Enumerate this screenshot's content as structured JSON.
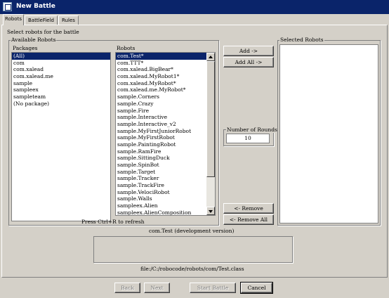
{
  "window": {
    "title": "New Battle"
  },
  "tabs": [
    {
      "label": "Robots"
    },
    {
      "label": "BattleField"
    },
    {
      "label": "Rules"
    }
  ],
  "robots_tab": {
    "instruction": "Select robots for the battle",
    "available_label": "Available Robots",
    "packages_header": "Packages",
    "packages": [
      "(All)",
      "com",
      "com.xalead",
      "com.xalead.me",
      "sample",
      "sampleex",
      "sampleteam",
      "(No package)"
    ],
    "selected_package": "(All)",
    "robots_header": "Robots",
    "robots": [
      "com.Test*",
      "com.TTT*",
      "com.xalead.BigBear*",
      "com.xalead.MyRobot1*",
      "com.xalead.MyRobot*",
      "com.xalead.me.MyRobot*",
      "sample.Corners",
      "sample.Crazy",
      "sample.Fire",
      "sample.Interactive",
      "sample.Interactive_v2",
      "sample.MyFirstJuniorRobot",
      "sample.MyFirstRobot",
      "sample.PaintingRobot",
      "sample.RamFire",
      "sample.SittingDuck",
      "sample.SpinBot",
      "sample.Target",
      "sample.Tracker",
      "sample.TrackFire",
      "sample.VelociRobot",
      "sample.Walls",
      "sampleex.Alien",
      "sampleex.AlienComposition"
    ],
    "selected_robot": "com.Test*",
    "refresh_hint": "Press Ctrl+R to refresh",
    "add_button": "Add ->",
    "add_all_button": "Add All ->",
    "rounds_label": "Number of Rounds",
    "rounds_value": "10",
    "remove_button": "<- Remove",
    "remove_all_button": "<- Remove All",
    "selected_label": "Selected Robots",
    "selected_robots": [],
    "robot_description_title": "com.Test (development version)",
    "robot_description": "",
    "robot_file": "file:/C:/robocode/robots/com/Test.class"
  },
  "footer": {
    "back": "Back",
    "next": "Next",
    "start": "Start Battle",
    "cancel": "Cancel"
  },
  "colors": {
    "titlebar": "#0a246a",
    "face": "#d4d0c8",
    "selection": "#0a246a"
  }
}
